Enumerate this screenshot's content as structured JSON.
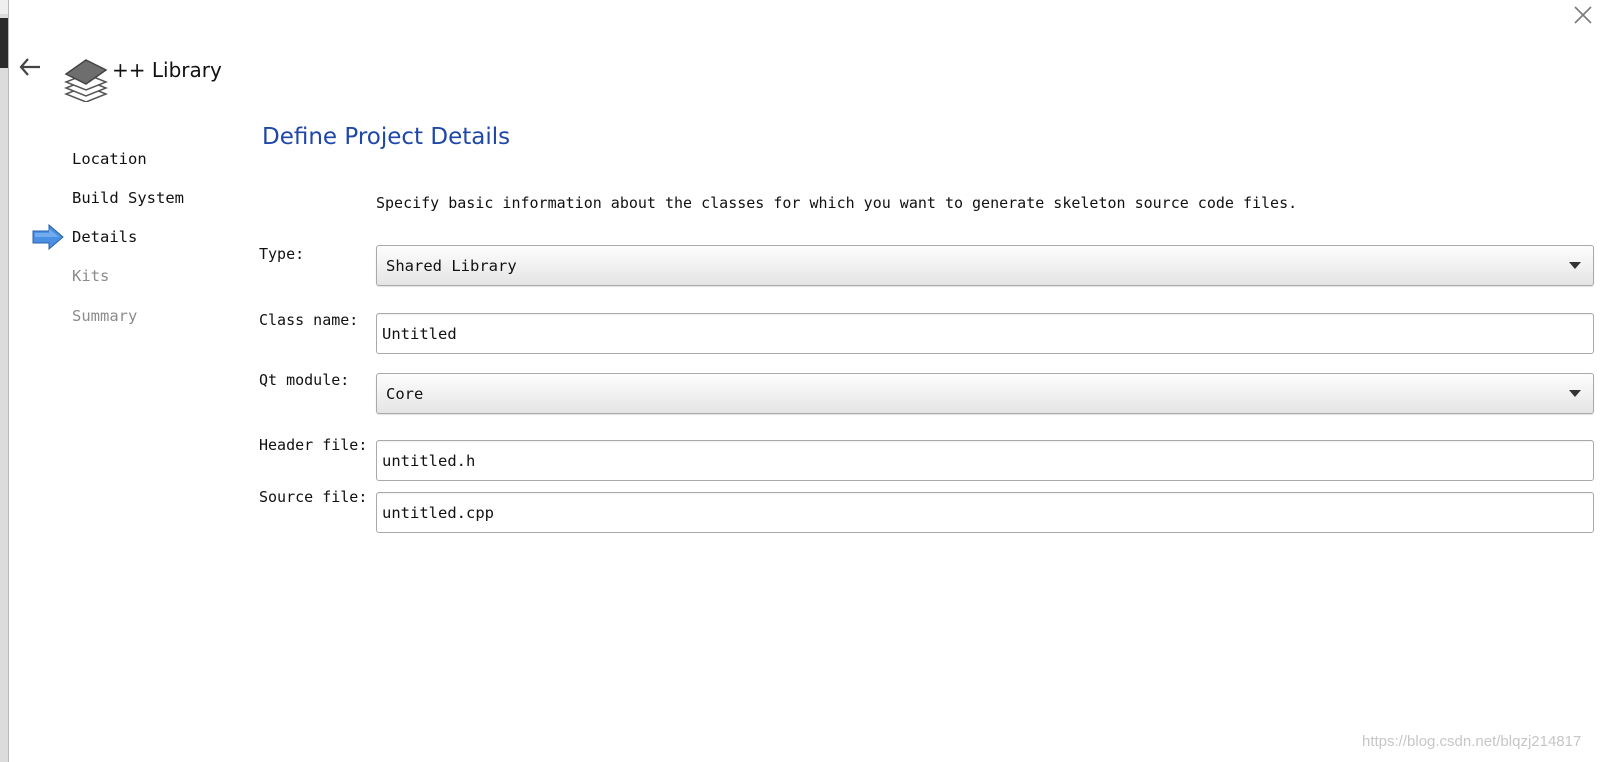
{
  "wizard": {
    "title": "++ Library",
    "icon": "stacked-layers-icon",
    "close_icon": "close-icon",
    "back_icon": "back-arrow-icon"
  },
  "steps": [
    {
      "label": "Location",
      "state": "done"
    },
    {
      "label": "Build System",
      "state": "done"
    },
    {
      "label": "Details",
      "state": "current"
    },
    {
      "label": "Kits",
      "state": "upcoming"
    },
    {
      "label": "Summary",
      "state": "upcoming"
    }
  ],
  "page": {
    "heading": "Define Project Details",
    "description": "Specify basic information about the classes for which you want to generate skeleton source code files."
  },
  "form": {
    "type": {
      "label": "Type:",
      "value": "Shared Library"
    },
    "class_name": {
      "label": "Class name:",
      "value": "Untitled"
    },
    "qt_module": {
      "label": "Qt module:",
      "value": "Core"
    },
    "header_file": {
      "label": "Header file:",
      "value": "untitled.h"
    },
    "source_file": {
      "label": "Source file:",
      "value": "untitled.cpp"
    }
  },
  "watermark": "https://blog.csdn.net/blqzj214817",
  "colors": {
    "heading": "#1e47a8",
    "inactive_step": "#8c8c8c",
    "step_arrow": "#4a90e2"
  }
}
